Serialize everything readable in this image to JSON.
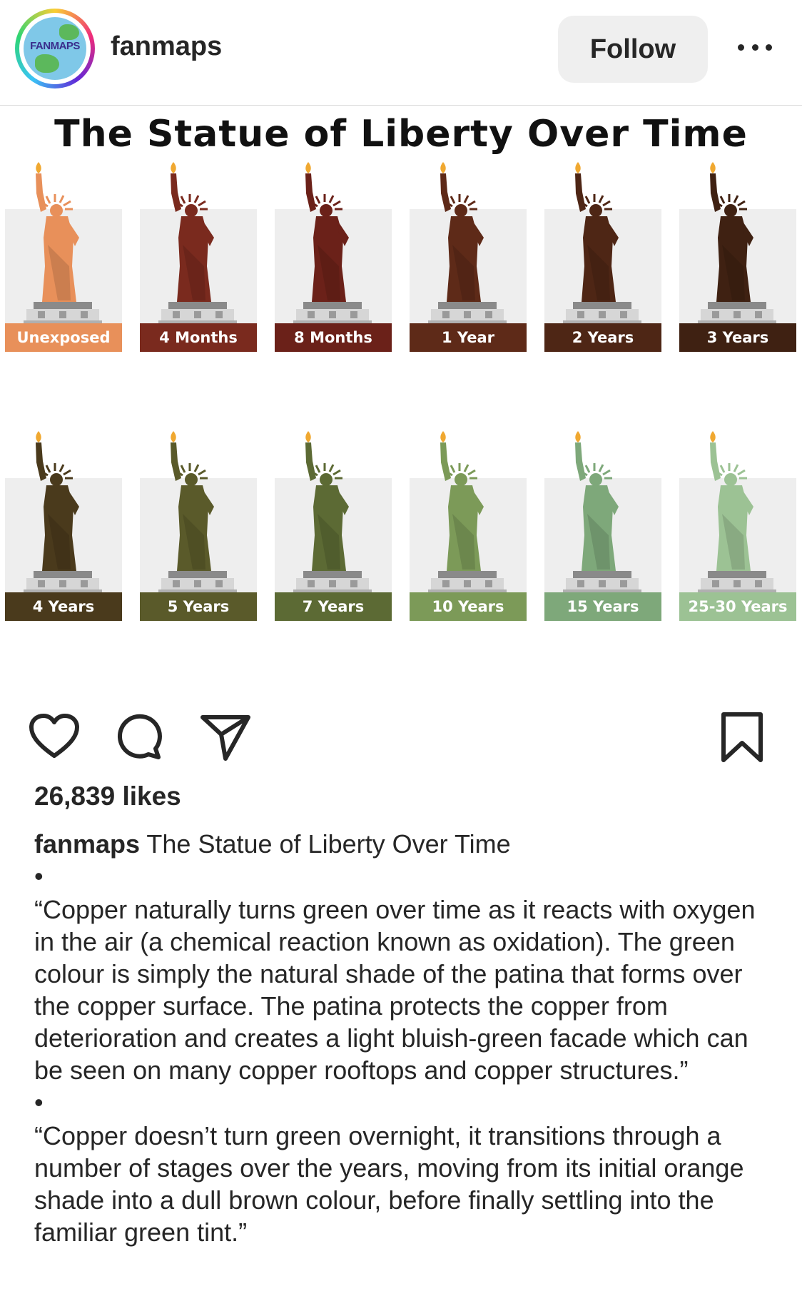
{
  "header": {
    "avatar_text": "FANMAPS",
    "username": "fanmaps",
    "follow_label": "Follow",
    "more_icon": "more-horizontal-icon"
  },
  "post_image": {
    "title": "The Statue of Liberty Over Time",
    "stages": [
      {
        "label": "Unexposed",
        "color": "#e8905a",
        "label_color": "#e8905a"
      },
      {
        "label": "4 Months",
        "color": "#7a2a1e",
        "label_color": "#7a2a1e"
      },
      {
        "label": "8 Months",
        "color": "#6b2119",
        "label_color": "#6b2119"
      },
      {
        "label": "1 Year",
        "color": "#5e2a18",
        "label_color": "#5e2a18"
      },
      {
        "label": "2 Years",
        "color": "#4e2615",
        "label_color": "#4e2615"
      },
      {
        "label": "3 Years",
        "color": "#3f2112",
        "label_color": "#3f2112"
      },
      {
        "label": "4 Years",
        "color": "#4a3a1c",
        "label_color": "#4a3a1c"
      },
      {
        "label": "5 Years",
        "color": "#5a5a2a",
        "label_color": "#5a5a2a"
      },
      {
        "label": "7 Years",
        "color": "#5c6a34",
        "label_color": "#5c6a34"
      },
      {
        "label": "10 Years",
        "color": "#7c9a58",
        "label_color": "#7c9a58"
      },
      {
        "label": "15 Years",
        "color": "#7ea87a",
        "label_color": "#7ea87a"
      },
      {
        "label": "25-30 Years",
        "color": "#9cc294",
        "label_color": "#9cc294"
      }
    ]
  },
  "actions": {
    "like_icon": "heart-icon",
    "comment_icon": "comment-icon",
    "share_icon": "send-icon",
    "save_icon": "bookmark-icon"
  },
  "likes": "26,839 likes",
  "caption": {
    "author": "fanmaps",
    "text": "The Statue of Liberty Over Time",
    "bullet": "•",
    "paragraph1": "“Copper naturally turns green over time as it reacts with oxygen in the air (a chemical reaction known as oxidation). The green colour is simply the natural shade of the patina that forms over the copper surface. The patina protects the copper from deterioration and creates a light bluish-green facade which can be seen on many copper rooftops and copper structures.”",
    "paragraph2": "“Copper doesn’t turn green overnight, it transitions through a number of stages over the years, moving from its initial orange shade into a dull brown colour, before finally settling into the familiar green tint.”"
  }
}
